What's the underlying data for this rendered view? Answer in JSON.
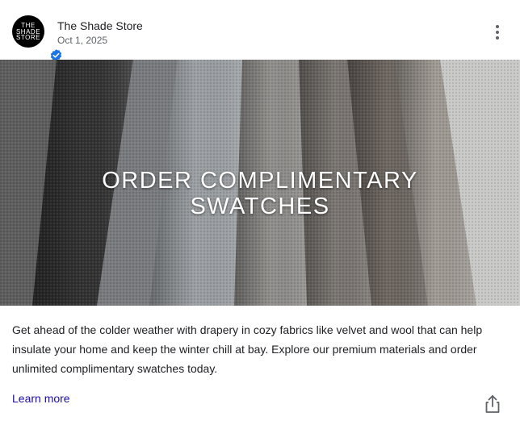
{
  "post": {
    "author": "The Shade Store",
    "date": "Oct 1, 2025",
    "avatar_text": [
      "THE",
      "SHADE",
      "STORE"
    ],
    "image_title_line1": "ORDER COMPLIMENTARY",
    "image_title_line2": "SWATCHES",
    "body": "Get ahead of the colder weather with drapery in cozy fabrics like velvet and wool that can help insulate your home and keep the winter chill at bay. Explore our premium materials and order unlimited complimentary swatches today.",
    "cta_label": "Learn more"
  },
  "icons": {
    "more": "more-vert-icon",
    "share": "share-icon",
    "verified": "verified-badge-icon"
  },
  "colors": {
    "link": "#1a0dab",
    "verified": "#1a73e8",
    "secondary_text": "#5f6368"
  }
}
